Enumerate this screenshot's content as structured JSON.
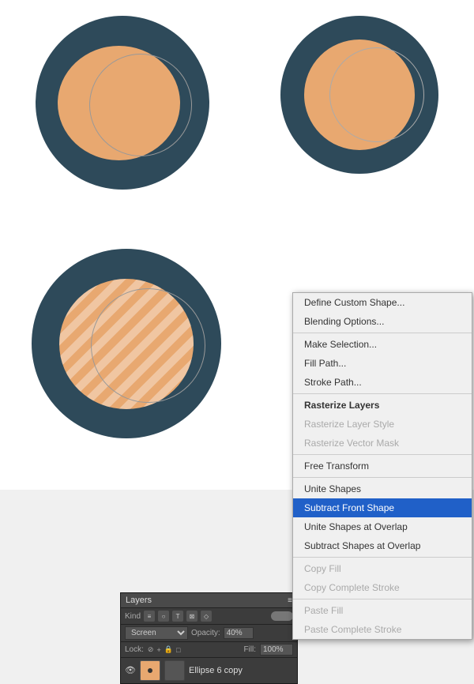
{
  "canvas": {
    "bg": "#ffffff"
  },
  "scene_tl": {
    "label": "scene-top-left"
  },
  "scene_tr": {
    "label": "scene-top-right"
  },
  "scene_bl": {
    "label": "scene-bottom-left"
  },
  "context_menu": {
    "items": [
      {
        "id": "define-custom-shape",
        "label": "Define Custom Shape...",
        "state": "normal"
      },
      {
        "id": "blending-options",
        "label": "Blending Options...",
        "state": "normal"
      },
      {
        "id": "sep1",
        "type": "separator"
      },
      {
        "id": "make-selection",
        "label": "Make Selection...",
        "state": "normal"
      },
      {
        "id": "fill-path",
        "label": "Fill Path...",
        "state": "normal"
      },
      {
        "id": "stroke-path",
        "label": "Stroke Path...",
        "state": "normal"
      },
      {
        "id": "sep2",
        "type": "separator"
      },
      {
        "id": "rasterize-layers",
        "label": "Rasterize Layers",
        "state": "bold"
      },
      {
        "id": "rasterize-layer-style",
        "label": "Rasterize Layer Style",
        "state": "disabled"
      },
      {
        "id": "rasterize-vector-mask",
        "label": "Rasterize Vector Mask",
        "state": "disabled"
      },
      {
        "id": "sep3",
        "type": "separator"
      },
      {
        "id": "free-transform",
        "label": "Free Transform",
        "state": "normal"
      },
      {
        "id": "sep4",
        "type": "separator"
      },
      {
        "id": "unite-shapes",
        "label": "Unite Shapes",
        "state": "normal"
      },
      {
        "id": "subtract-front-shape",
        "label": "Subtract Front Shape",
        "state": "highlighted"
      },
      {
        "id": "unite-shapes-at-overlap",
        "label": "Unite Shapes at Overlap",
        "state": "normal"
      },
      {
        "id": "subtract-shapes-at-overlap",
        "label": "Subtract Shapes at Overlap",
        "state": "normal"
      },
      {
        "id": "sep5",
        "type": "separator"
      },
      {
        "id": "copy-fill",
        "label": "Copy Fill",
        "state": "disabled"
      },
      {
        "id": "copy-complete-stroke",
        "label": "Copy Complete Stroke",
        "state": "disabled"
      },
      {
        "id": "sep6",
        "type": "separator"
      },
      {
        "id": "paste-fill",
        "label": "Paste Fill",
        "state": "disabled"
      },
      {
        "id": "paste-complete-stroke",
        "label": "Paste Complete Stroke",
        "state": "disabled"
      }
    ]
  },
  "layers_panel": {
    "title": "Layers",
    "filter_label": "Kind",
    "mode_value": "Screen",
    "opacity_label": "Opacity:",
    "opacity_value": "40%",
    "lock_label": "Lock:",
    "fill_label": "Fill:",
    "fill_value": "100%",
    "layer_name": "Ellipse 6 copy",
    "filter_icons": [
      "≡",
      "○",
      "T",
      "⊠",
      "◇"
    ],
    "lock_icons": [
      "⊘",
      "+",
      "🔒",
      "□"
    ]
  }
}
